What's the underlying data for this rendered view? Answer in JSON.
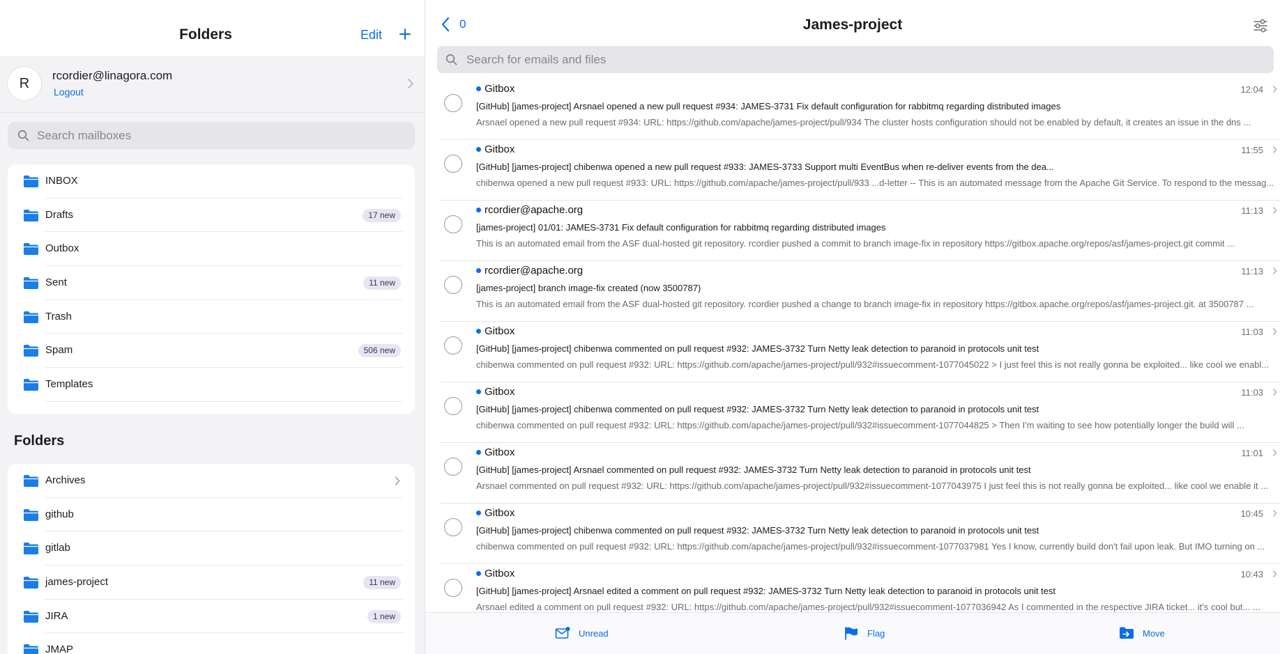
{
  "sidebar": {
    "title": "Folders",
    "edit_label": "Edit",
    "account": {
      "avatar_letter": "R",
      "email": "rcordier@linagora.com",
      "logout_label": "Logout"
    },
    "search_placeholder": "Search mailboxes",
    "mailboxes": [
      {
        "name": "INBOX",
        "badge": ""
      },
      {
        "name": "Drafts",
        "badge": "17 new"
      },
      {
        "name": "Outbox",
        "badge": ""
      },
      {
        "name": "Sent",
        "badge": "11 new"
      },
      {
        "name": "Trash",
        "badge": ""
      },
      {
        "name": "Spam",
        "badge": "506 new"
      },
      {
        "name": "Templates",
        "badge": ""
      }
    ],
    "folders_heading": "Folders",
    "folders": [
      {
        "name": "Archives",
        "badge": ""
      },
      {
        "name": "github",
        "badge": ""
      },
      {
        "name": "gitlab",
        "badge": ""
      },
      {
        "name": "james-project",
        "badge": "11 new"
      },
      {
        "name": "JIRA",
        "badge": "1 new"
      },
      {
        "name": "JMAP",
        "badge": ""
      }
    ]
  },
  "main": {
    "back_count": "0",
    "title": "James-project",
    "search_placeholder": "Search for emails and files",
    "messages": [
      {
        "from": "Gitbox",
        "time": "12:04",
        "subject": "[GitHub] [james-project] Arsnael opened a new pull request #934: JAMES-3731 Fix default configuration for rabbitmq regarding distributed images",
        "preview": "Arsnael opened a new pull request #934: URL: https://github.com/apache/james-project/pull/934 The cluster hosts configuration should not be enabled by default, it creates an issue in the dns ..."
      },
      {
        "from": "Gitbox",
        "time": "11:55",
        "subject": "[GitHub] [james-project] chibenwa opened a new pull request #933: JAMES-3733 Support multi EventBus when re-deliver events from the dea...",
        "preview": "chibenwa opened a new pull request #933: URL: https://github.com/apache/james-project/pull/933 ...d-letter -- This is an automated message from the Apache Git Service. To respond to the messag..."
      },
      {
        "from": "rcordier@apache.org",
        "time": "11:13",
        "subject": "[james-project] 01/01: JAMES-3731 Fix default configuration for rabbitmq regarding distributed images",
        "preview": "This is an automated email from the ASF dual-hosted git repository. rcordier pushed a commit to branch image-fix in repository https://gitbox.apache.org/repos/asf/james-project.git commit ..."
      },
      {
        "from": "rcordier@apache.org",
        "time": "11:13",
        "subject": "[james-project] branch image-fix created (now 3500787)",
        "preview": "This is an automated email from the ASF dual-hosted git repository. rcordier pushed a change to branch image-fix in repository https://gitbox.apache.org/repos/asf/james-project.git. at 3500787 ..."
      },
      {
        "from": "Gitbox",
        "time": "11:03",
        "subject": "[GitHub] [james-project] chibenwa commented on pull request #932: JAMES-3732 Turn Netty leak detection to paranoid in protocols unit test",
        "preview": "chibenwa commented on pull request #932: URL: https://github.com/apache/james-project/pull/932#issuecomment-1077045022 > I just feel this is not really gonna be exploited... like cool we enabl..."
      },
      {
        "from": "Gitbox",
        "time": "11:03",
        "subject": "[GitHub] [james-project] chibenwa commented on pull request #932: JAMES-3732 Turn Netty leak detection to paranoid in protocols unit test",
        "preview": "chibenwa commented on pull request #932: URL: https://github.com/apache/james-project/pull/932#issuecomment-1077044825 > Then I'm waiting to see how potentially longer the build will ..."
      },
      {
        "from": "Gitbox",
        "time": "11:01",
        "subject": "[GitHub] [james-project] Arsnael commented on pull request #932: JAMES-3732 Turn Netty leak detection to paranoid in protocols unit test",
        "preview": "Arsnael commented on pull request #932: URL: https://github.com/apache/james-project/pull/932#issuecomment-1077043975 I just feel this is not really gonna be exploited... like cool we enable it ..."
      },
      {
        "from": "Gitbox",
        "time": "10:45",
        "subject": "[GitHub] [james-project] chibenwa commented on pull request #932: JAMES-3732 Turn Netty leak detection to paranoid in protocols unit test",
        "preview": "chibenwa commented on pull request #932: URL: https://github.com/apache/james-project/pull/932#issuecomment-1077037981 Yes I know, currently build don't fail upon leak. But IMO turning on ..."
      },
      {
        "from": "Gitbox",
        "time": "10:43",
        "subject": "[GitHub] [james-project] Arsnael edited a comment on pull request #932: JAMES-3732 Turn Netty leak detection to paranoid in protocols unit test",
        "preview": "Arsnael edited a comment on pull request #932: URL: https://github.com/apache/james-project/pull/932#issuecomment-1077036942 As I commented in the respective JIRA ticket... it's cool but... ..."
      }
    ],
    "bottom_actions": {
      "unread_label": "Unread",
      "flag_label": "Flag",
      "move_label": "Move"
    }
  },
  "colors": {
    "accent": "#0a6ee6",
    "unread_dot": "#0a6ee6",
    "badge_bg": "#e7e4f3"
  }
}
